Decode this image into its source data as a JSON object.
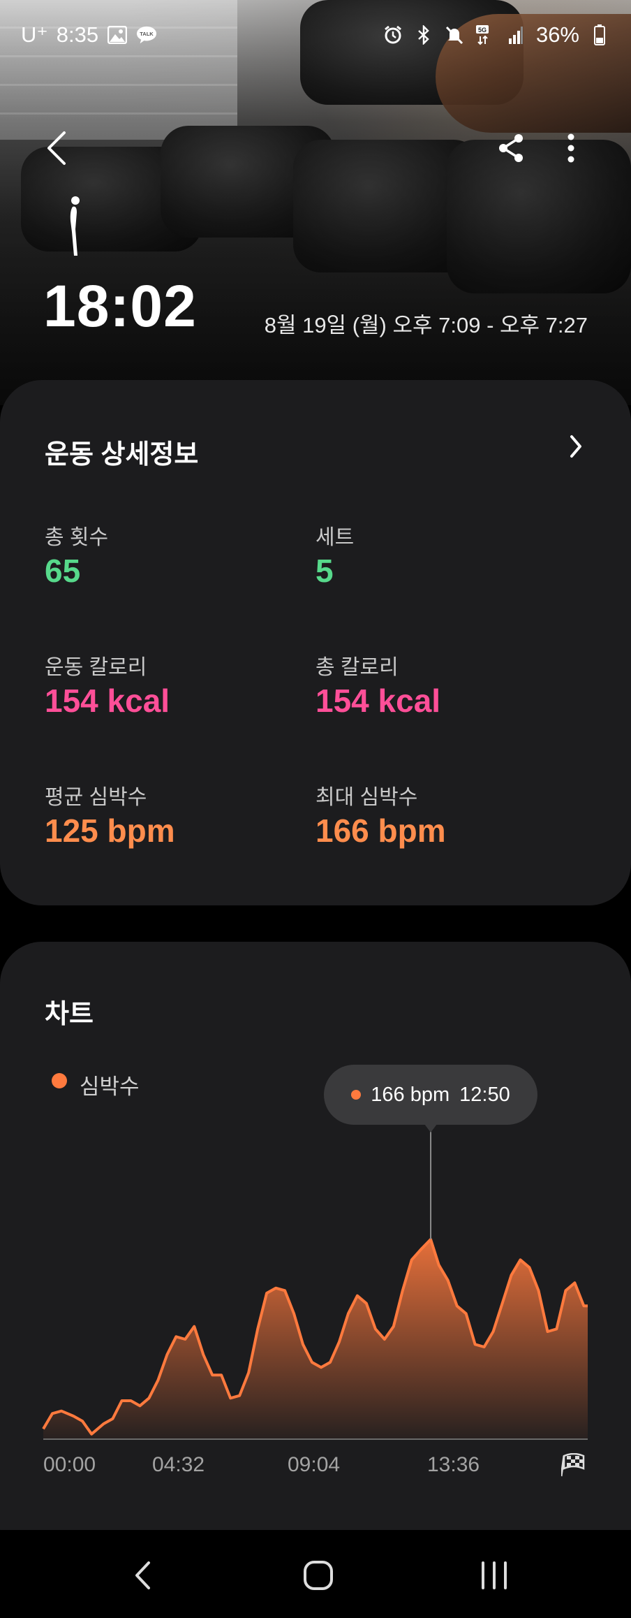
{
  "status_bar": {
    "carrier": "U⁺",
    "time": "8:35",
    "battery": "36%",
    "left_icons": [
      "gallery-icon",
      "kakaotalk-icon"
    ],
    "right_icons": [
      "alarm-icon",
      "bluetooth-icon",
      "mute-icon",
      "5g-icon",
      "signal-icon",
      "battery-icon"
    ],
    "talk_label": "TALK"
  },
  "header": {
    "duration": "18:02",
    "date_range": "8월 19일 (월) 오후 7:09 - 오후 7:27",
    "icons": [
      "back-icon",
      "share-icon",
      "more-icon",
      "exercise-figure-icon"
    ]
  },
  "details": {
    "title": "운동 상세정보",
    "metrics": [
      {
        "label": "총 횟수",
        "value": "65",
        "color": "#57d98b"
      },
      {
        "label": "세트",
        "value": "5",
        "color": "#57d98b"
      },
      {
        "label": "운동 칼로리",
        "value": "154 kcal",
        "color": "#ff4f98"
      },
      {
        "label": "총 칼로리",
        "value": "154 kcal",
        "color": "#ff4f98"
      },
      {
        "label": "평균 심박수",
        "value": "125 bpm",
        "color": "#ff8d4d"
      },
      {
        "label": "최대 심박수",
        "value": "166 bpm",
        "color": "#ff8d4d"
      }
    ]
  },
  "chart": {
    "title": "차트",
    "legend": "심박수",
    "tooltip": {
      "value": "166 bpm",
      "time": "12:50"
    },
    "x_ticks": [
      "00:00",
      "04:32",
      "09:04",
      "13:36"
    ],
    "end_icon": "finish-flag-icon",
    "accent": "#ff7a3e"
  },
  "chart_data": {
    "type": "area",
    "series": [
      {
        "name": "심박수",
        "x_minutes": [
          0.0,
          0.3,
          0.6,
          1.0,
          1.3,
          1.6,
          2.0,
          2.3,
          2.6,
          2.9,
          3.2,
          3.5,
          3.8,
          4.1,
          4.4,
          4.7,
          5.0,
          5.3,
          5.6,
          5.9,
          6.2,
          6.5,
          6.8,
          7.1,
          7.4,
          7.7,
          8.0,
          8.3,
          8.6,
          8.9,
          9.2,
          9.5,
          9.8,
          10.1,
          10.4,
          10.7,
          11.0,
          11.3,
          11.6,
          11.9,
          12.2,
          12.5,
          12.83,
          13.1,
          13.4,
          13.7,
          14.0,
          14.3,
          14.6,
          14.9,
          15.2,
          15.5,
          15.8,
          16.1,
          16.4,
          16.7,
          17.0,
          17.3,
          17.6,
          17.9,
          18.03
        ],
        "values": [
          92,
          98,
          99,
          97,
          95,
          90,
          94,
          96,
          103,
          103,
          101,
          104,
          111,
          121,
          128,
          127,
          132,
          121,
          113,
          113,
          104,
          105,
          114,
          131,
          145,
          147,
          146,
          137,
          125,
          118,
          116,
          118,
          126,
          137,
          144,
          141,
          131,
          127,
          132,
          146,
          158,
          162,
          166,
          156,
          150,
          140,
          137,
          125,
          124,
          130,
          141,
          152,
          158,
          155,
          146,
          130,
          131,
          146,
          149,
          140,
          140
        ]
      }
    ],
    "x_tick_labels": [
      "00:00",
      "04:32",
      "09:04",
      "13:36"
    ],
    "highlight": {
      "x_minutes": 12.83,
      "value": 166
    },
    "ylim": [
      88,
      172
    ]
  }
}
